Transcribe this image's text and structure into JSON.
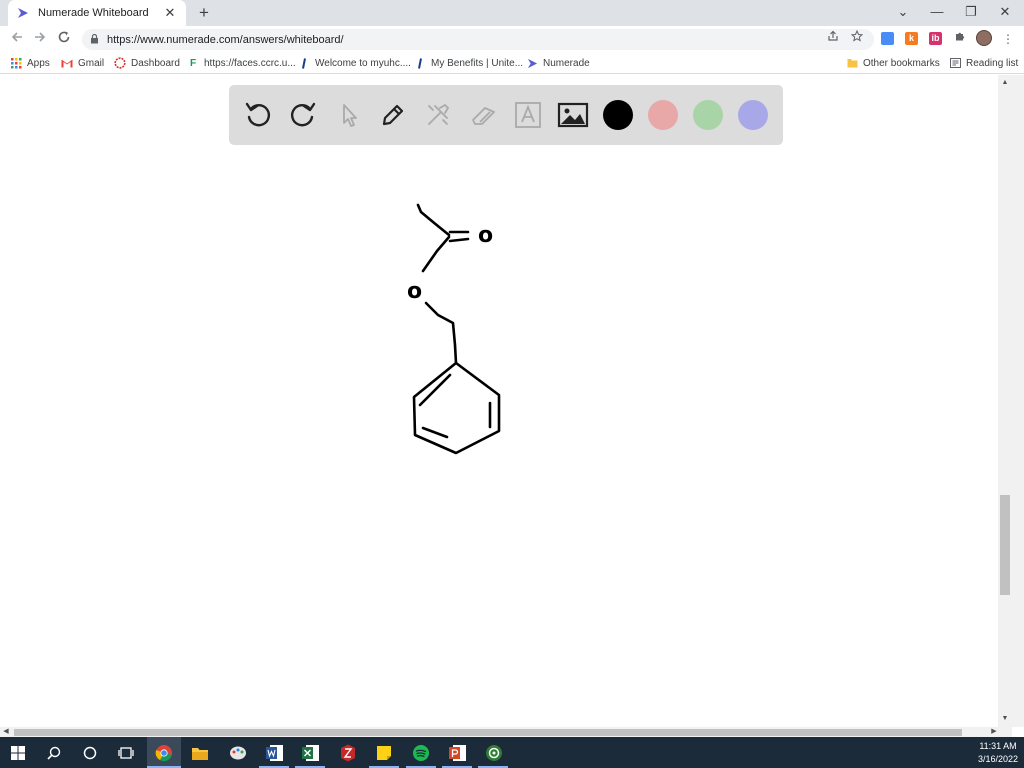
{
  "browser": {
    "tab_title": "Numerade Whiteboard",
    "tab_close": "✕",
    "new_tab": "+",
    "url": "https://www.numerade.com/answers/whiteboard/",
    "window_controls": {
      "chevron": "⌄",
      "minimize": "—",
      "restore": "❐",
      "close": "✕"
    }
  },
  "bookmarks": {
    "items": [
      {
        "label": "Apps",
        "icon": "apps-grid-icon"
      },
      {
        "label": "Gmail",
        "icon": "gmail-icon"
      },
      {
        "label": "Dashboard",
        "icon": "dashboard-icon"
      },
      {
        "label": "https://faces.ccrc.u...",
        "icon": "faces-icon"
      },
      {
        "label": "Welcome to myuhc....",
        "icon": "uhc-icon"
      },
      {
        "label": "My Benefits | Unite...",
        "icon": "uhc-icon"
      },
      {
        "label": "Numerade",
        "icon": "numerade-icon"
      }
    ],
    "other": "Other bookmarks",
    "reading_list": "Reading list"
  },
  "whiteboard": {
    "tools": [
      "undo-icon",
      "redo-icon",
      "pointer-icon",
      "pen-icon",
      "tools-icon",
      "eraser-icon",
      "text-icon",
      "image-icon"
    ],
    "colors": [
      "#000000",
      "#e8a8a8",
      "#a8d4a8",
      "#a8a8e8"
    ],
    "drawing": "benzyl acetate structure sketch",
    "labels": {
      "carbonyl_oxygen": "o",
      "ester_oxygen": "o"
    }
  },
  "taskbar": {
    "apps": [
      "windows-start-icon",
      "search-icon",
      "cortana-icon",
      "task-view-icon",
      "chrome-icon",
      "file-explorer-icon",
      "paint-icon",
      "word-icon",
      "excel-icon",
      "app-red-icon",
      "sticky-notes-icon",
      "spotify-icon",
      "powerpoint-icon",
      "camtasia-icon"
    ],
    "time": "11:31 AM",
    "date": "3/16/2022"
  }
}
